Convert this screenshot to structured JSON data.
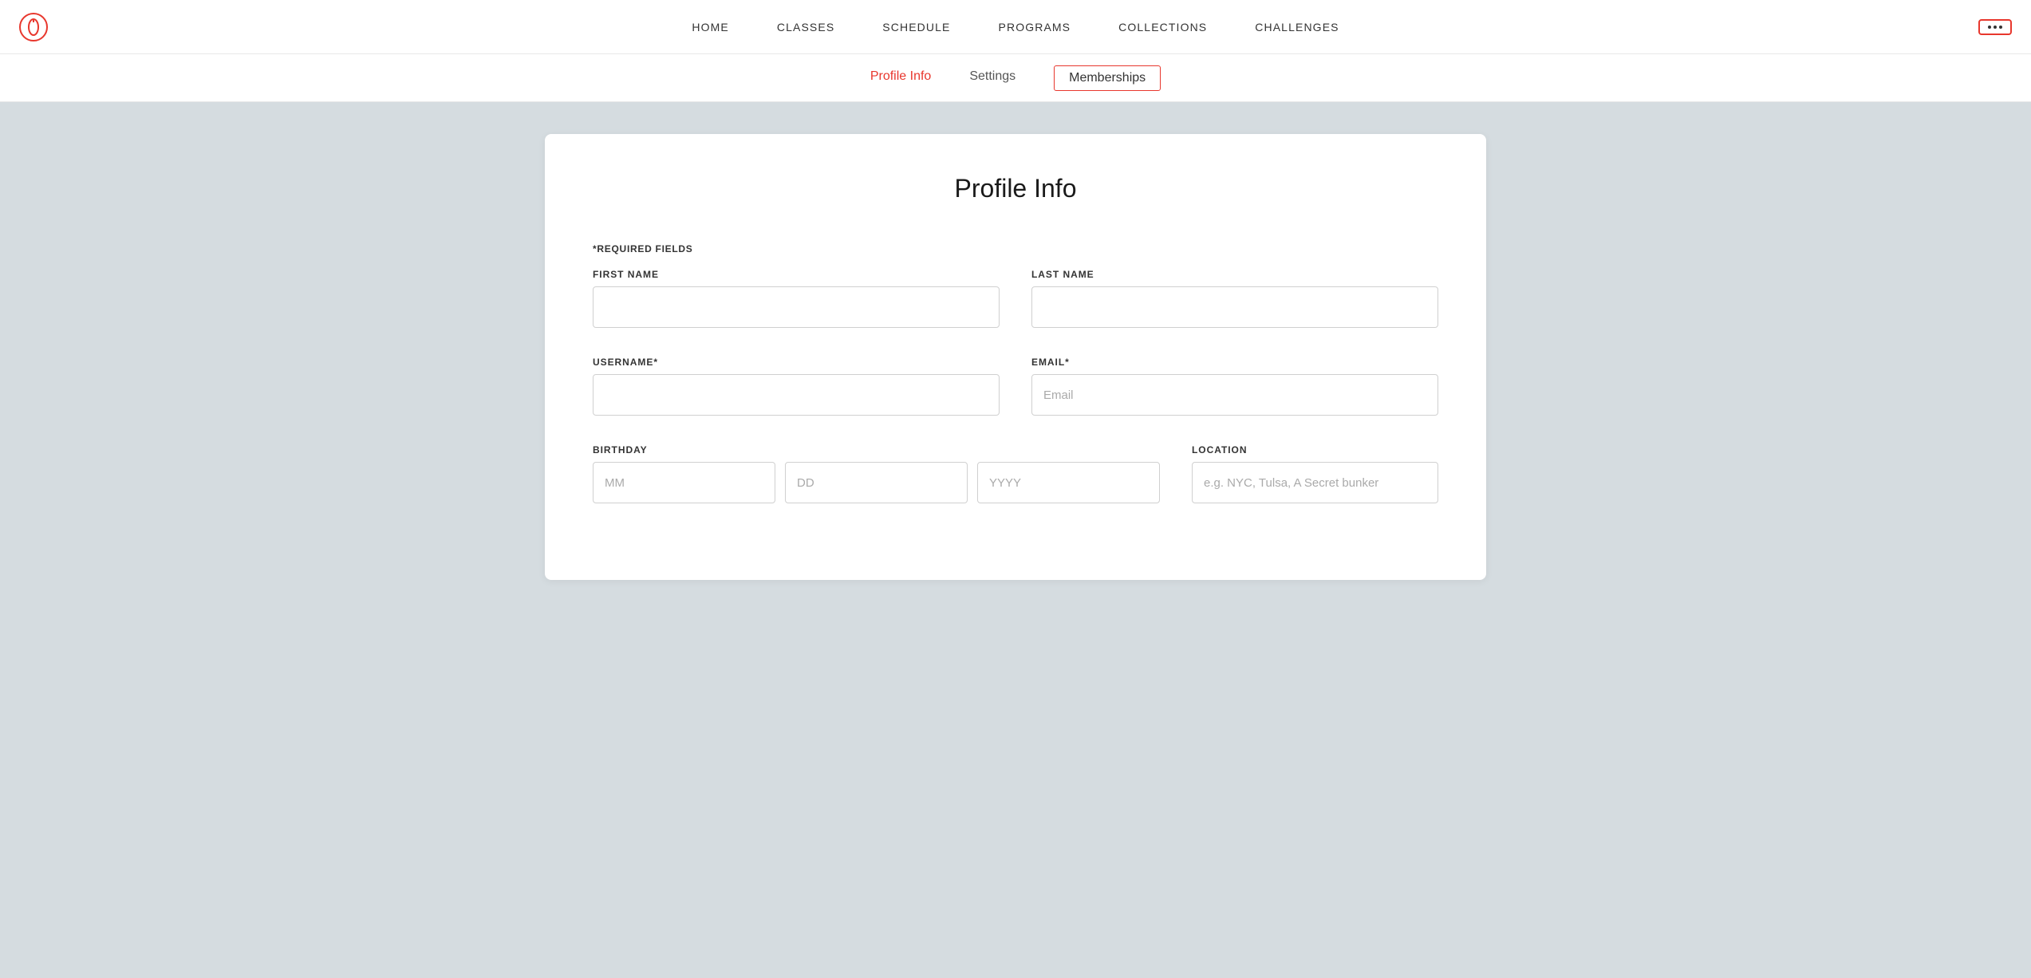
{
  "navbar": {
    "logo_alt": "Peloton Logo",
    "links": [
      {
        "id": "home",
        "label": "HOME"
      },
      {
        "id": "classes",
        "label": "CLASSES"
      },
      {
        "id": "schedule",
        "label": "SCHEDULE"
      },
      {
        "id": "programs",
        "label": "PROGRAMS"
      },
      {
        "id": "collections",
        "label": "COLLECTIONS"
      },
      {
        "id": "challenges",
        "label": "CHALLENGES"
      }
    ],
    "more_label": "···"
  },
  "subnav": {
    "tabs": [
      {
        "id": "profile-info",
        "label": "Profile Info",
        "state": "active"
      },
      {
        "id": "settings",
        "label": "Settings",
        "state": "normal"
      },
      {
        "id": "memberships",
        "label": "Memberships",
        "state": "outlined"
      }
    ]
  },
  "form": {
    "title": "Profile Info",
    "required_note": "*REQUIRED FIELDS",
    "fields": {
      "first_name_label": "FIRST NAME",
      "last_name_label": "LAST NAME",
      "username_label": "USERNAME*",
      "email_label": "EMAIL*",
      "email_placeholder": "Email",
      "birthday_label": "BIRTHDAY",
      "location_label": "LOCATION",
      "mm_placeholder": "MM",
      "dd_placeholder": "DD",
      "yyyy_placeholder": "YYYY",
      "location_placeholder": "e.g. NYC, Tulsa, A Secret bunker"
    }
  }
}
